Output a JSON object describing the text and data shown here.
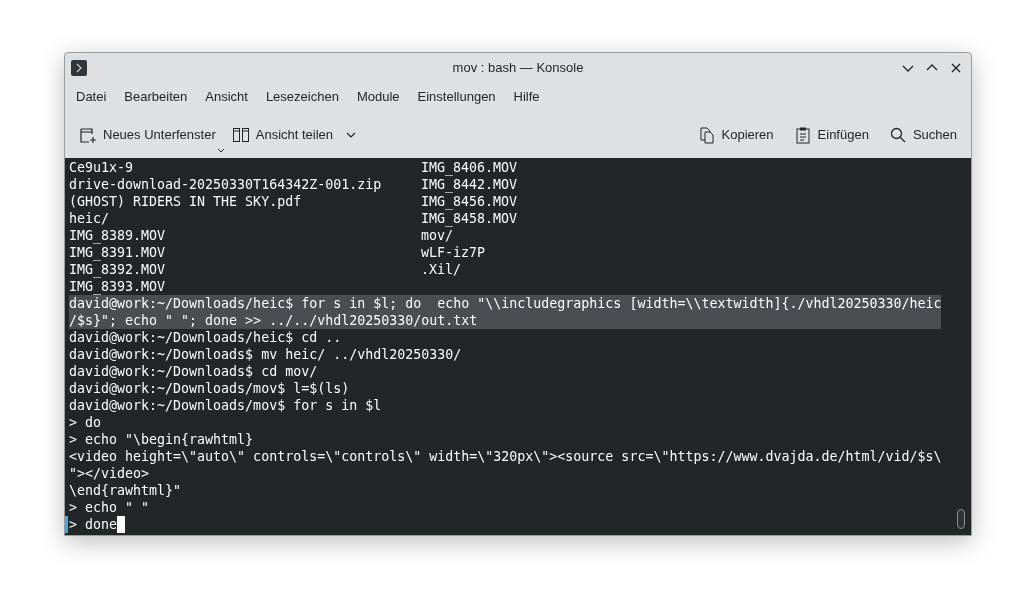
{
  "window": {
    "title": "mov : bash — Konsole"
  },
  "menu": [
    "Datei",
    "Bearbeiten",
    "Ansicht",
    "Lesezeichen",
    "Module",
    "Einstellungen",
    "Hilfe"
  ],
  "toolbar": {
    "left": [
      {
        "label": "Neues Unterfenster",
        "kind": "new-tab"
      },
      {
        "label": "Ansicht teilen",
        "kind": "split"
      }
    ],
    "right": [
      {
        "label": "Kopieren",
        "kind": "copy"
      },
      {
        "label": "Einfügen",
        "kind": "paste"
      },
      {
        "label": "Suchen",
        "kind": "search"
      }
    ]
  },
  "terminal": {
    "lines": [
      {
        "kind": "listing",
        "columns": [
          "Ce9u1x-9",
          "IMG_8406.MOV"
        ]
      },
      {
        "kind": "listing",
        "columns": [
          "drive-download-20250330T164342Z-001.zip",
          "IMG_8442.MOV"
        ]
      },
      {
        "kind": "listing",
        "columns": [
          "(GHOST) RIDERS IN THE SKY.pdf",
          "IMG_8456.MOV"
        ]
      },
      {
        "kind": "listing",
        "columns": [
          "heic/",
          "IMG_8458.MOV"
        ]
      },
      {
        "kind": "listing",
        "columns": [
          "IMG_8389.MOV",
          "mov/"
        ]
      },
      {
        "kind": "listing",
        "columns": [
          "IMG_8391.MOV",
          "wLF-iz7P"
        ]
      },
      {
        "kind": "listing",
        "columns": [
          "IMG_8392.MOV",
          ".Xil/"
        ]
      },
      {
        "kind": "listing",
        "columns": [
          "IMG_8393.MOV"
        ]
      },
      {
        "kind": "line",
        "text": "david@work:~/Downloads/heic$ for s in $l; do  echo \"\\\\includegraphics [width=\\\\textwidth]{./vhdl20250330/heic",
        "selected": true
      },
      {
        "kind": "line",
        "text": "/$s}\"; echo \" \"; done >> ../../vhdl20250330/out.txt",
        "selected": true
      },
      {
        "kind": "line",
        "text": "david@work:~/Downloads/heic$ cd ..",
        "selected": false
      },
      {
        "kind": "line",
        "text": "david@work:~/Downloads$ mv heic/ ../vhdl20250330/",
        "selected": false
      },
      {
        "kind": "line",
        "text": "david@work:~/Downloads$ cd mov/",
        "selected": false
      },
      {
        "kind": "line",
        "text": "david@work:~/Downloads/mov$ l=$(ls)",
        "selected": false
      },
      {
        "kind": "line",
        "text": "david@work:~/Downloads/mov$ for s in $l",
        "selected": false
      },
      {
        "kind": "line",
        "text": "> do",
        "selected": false
      },
      {
        "kind": "line",
        "text": "> echo \"\\begin{rawhtml}",
        "selected": false
      },
      {
        "kind": "line",
        "text": "<video height=\\\"auto\\\" controls=\\\"controls\\\" width=\\\"320px\\\"><source src=\\\"https://www.dvajda.de/html/vid/$s\\",
        "selected": false
      },
      {
        "kind": "line",
        "text": "\"></video>",
        "selected": false
      },
      {
        "kind": "line",
        "text": "\\end{rawhtml}\"",
        "selected": false
      },
      {
        "kind": "line",
        "text": "> echo \" \"",
        "selected": false
      },
      {
        "kind": "line",
        "text": "> done",
        "selected": false,
        "cursor": true
      }
    ]
  }
}
